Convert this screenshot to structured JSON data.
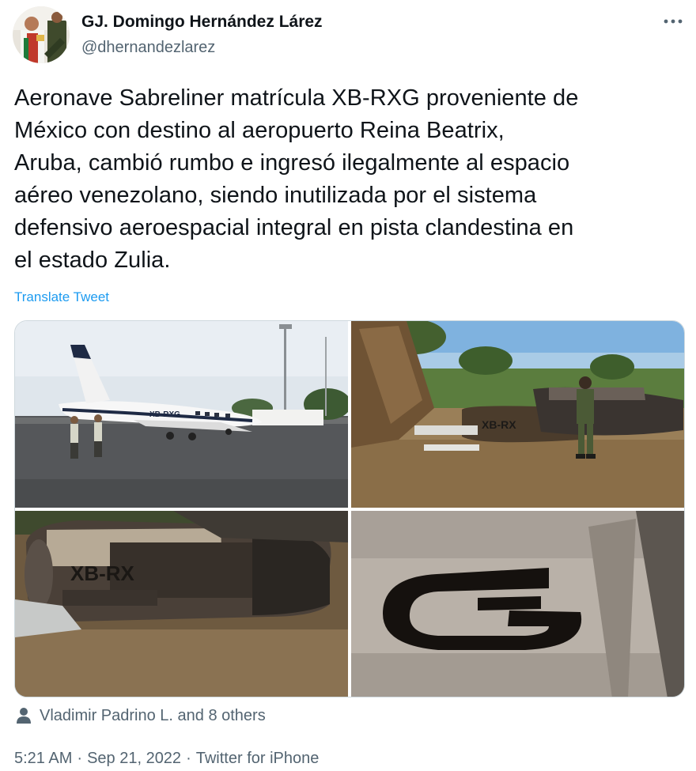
{
  "author": {
    "display_name": "GJ. Domingo Hernández Lárez",
    "handle": "@dhernandezlarez"
  },
  "tweet": {
    "text": "Aeronave Sabreliner matrícula XB-RXG  proveniente de\nMéxico  con destino al aeropuerto Reina Beatrix,\nAruba, cambió rumbo e  ingresó ilegalmente al espacio\naéreo venezolano, siendo inutilizada por el sistema\ndefensivo aeroespacial integral en pista clandestina en\nel estado Zulia.",
    "translate_label": "Translate Tweet"
  },
  "media": {
    "photo_1_registration": "XB-RXG",
    "photo_2_registration": "XB-RX",
    "photo_3_registration": "XB-RX"
  },
  "engagement": {
    "likes_text": "Vladimir Padrino L. and 8 others"
  },
  "meta": {
    "time": "5:21 AM",
    "date": "Sep 21, 2022",
    "source": "Twitter for iPhone",
    "separator": "·"
  },
  "icons": {
    "more": "more-options-icon",
    "likes": "person-icon"
  },
  "colors": {
    "text": "#0f1419",
    "secondary": "#536471",
    "link": "#1d9bf0"
  }
}
